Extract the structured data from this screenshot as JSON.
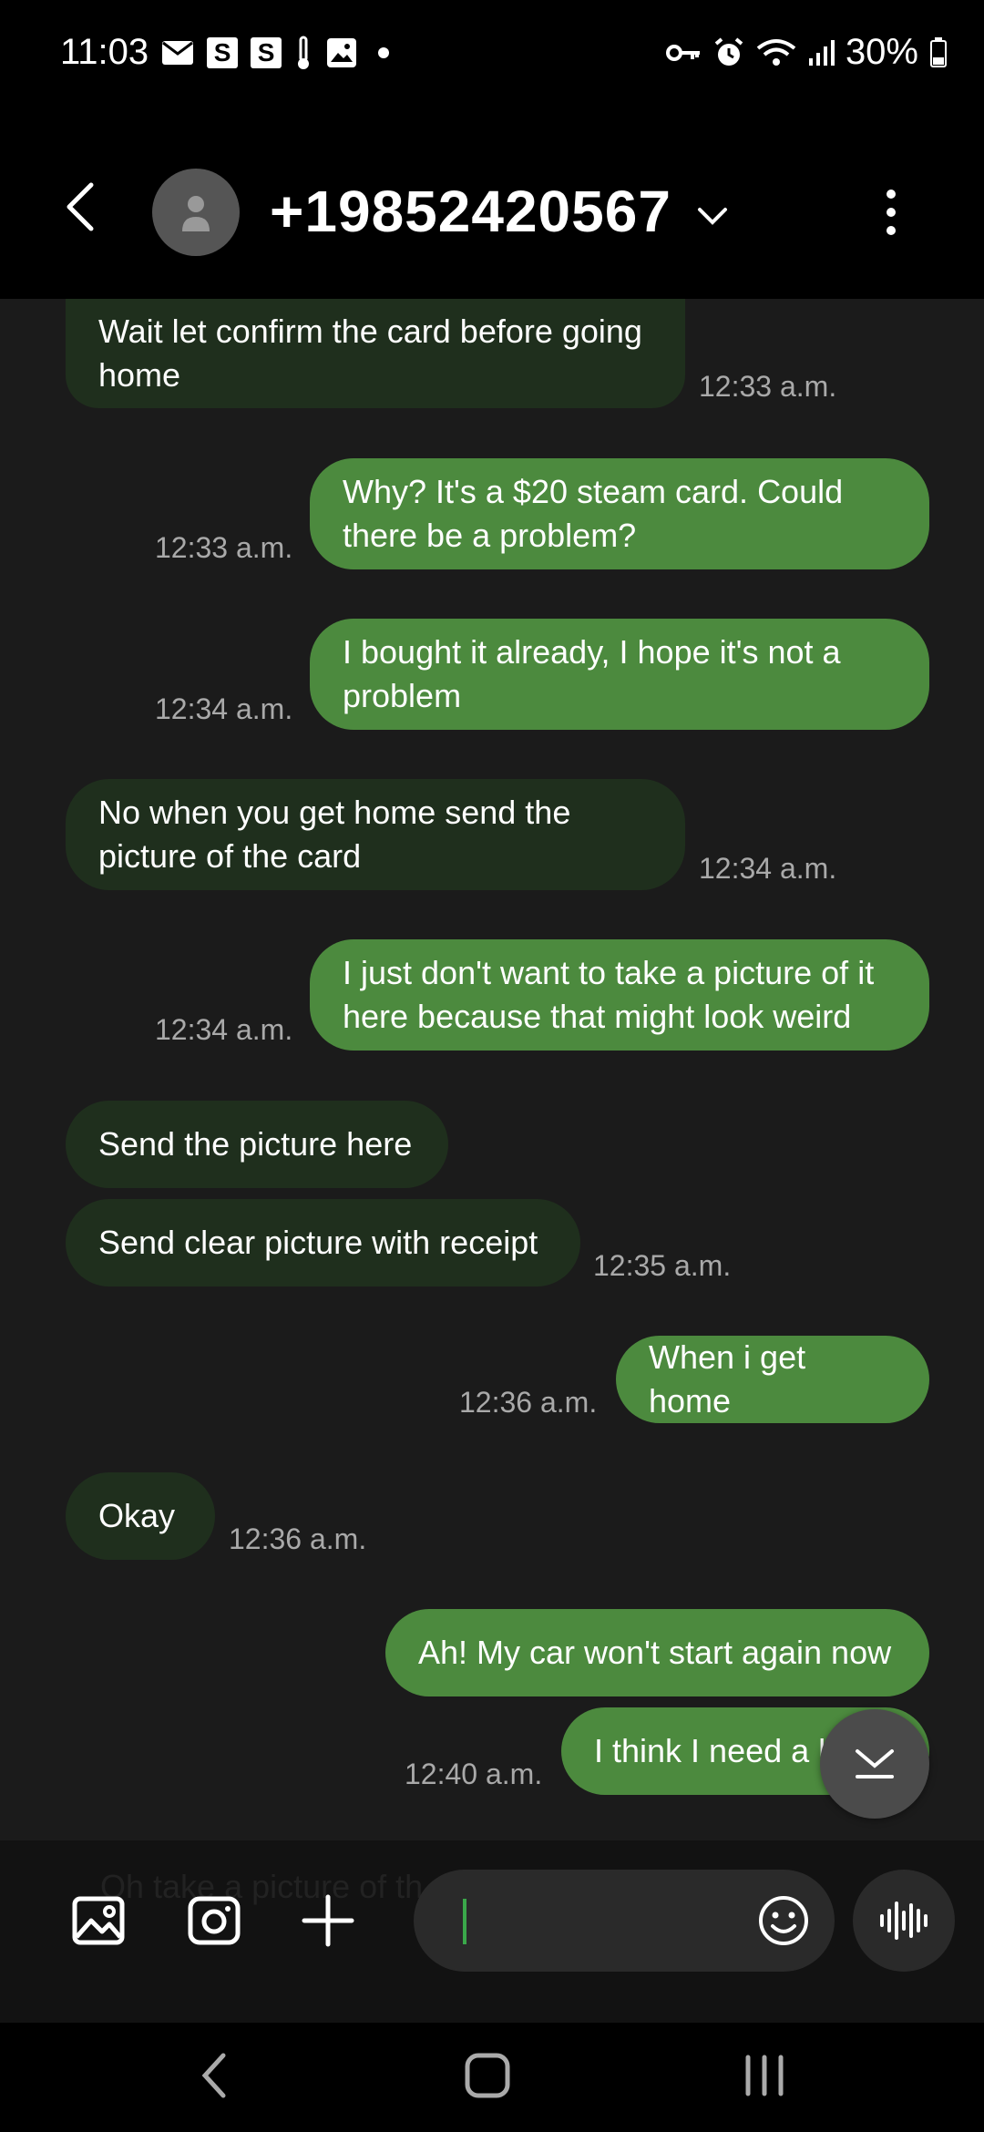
{
  "status_bar": {
    "time": "11:03",
    "left_icons": [
      "mail-icon",
      "s-app-icon",
      "s-app-icon",
      "thermometer-icon",
      "gallery-icon",
      "dot-icon"
    ],
    "s_label": "S",
    "right_icons": [
      "key-icon",
      "alarm-icon",
      "wifi-icon",
      "signal-icon",
      "battery-icon"
    ],
    "battery": "30%"
  },
  "header": {
    "title": "+19852420567",
    "icons": [
      "back-icon",
      "avatar-icon",
      "chevron-down-icon",
      "more-vert-icon"
    ]
  },
  "messages": [
    {
      "dir": "in",
      "text": "Wait let confirm the card before going home",
      "time": "12:33 a.m."
    },
    {
      "dir": "out",
      "text": "Why? It's a $20 steam card. Could there be a problem?",
      "time": "12:33 a.m."
    },
    {
      "dir": "out",
      "text": "I bought it already, I hope it's not a problem",
      "time": "12:34 a.m."
    },
    {
      "dir": "in",
      "text": "No when you get home send the picture of the card",
      "time": "12:34 a.m."
    },
    {
      "dir": "out",
      "text": "I just don't want to take a picture of it here because that might look weird",
      "time": "12:34 a.m."
    },
    {
      "dir": "in",
      "text": "Send the picture here",
      "time": ""
    },
    {
      "dir": "in",
      "text": "Send clear picture with receipt",
      "time": "12:35 a.m."
    },
    {
      "dir": "out",
      "text": "When i get home",
      "time": "12:36 a.m."
    },
    {
      "dir": "in",
      "text": "Okay",
      "time": "12:36 a.m."
    },
    {
      "dir": "out",
      "text": "Ah! My car won't start again now",
      "time": ""
    },
    {
      "dir": "out",
      "text": "I think I need a h",
      "time": "12:40 a.m."
    }
  ],
  "composer": {
    "ghost_text": "Oh take a picture of th",
    "icons": [
      "gallery-icon",
      "camera-icon",
      "plus-icon",
      "emoji-icon",
      "voice-icon"
    ]
  },
  "nav_bar": {
    "icons": [
      "nav-back-icon",
      "nav-home-icon",
      "nav-recents-icon"
    ]
  },
  "colors": {
    "incoming_bubble": "#1f2f1d",
    "outgoing_bubble": "#4c8a3e",
    "background": "#1b1b1b",
    "timestamp": "#a9a9a9",
    "caret": "#3aa84a"
  }
}
